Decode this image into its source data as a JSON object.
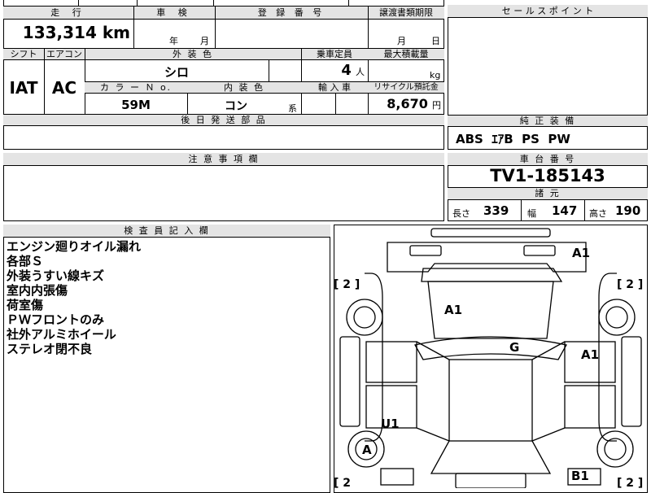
{
  "info": {
    "mileage_header": "走 行",
    "mileage_value": "133,314",
    "mileage_unit": "km",
    "shaken_header": "車 検",
    "shaken_year": "年",
    "shaken_month": "月",
    "plate_header": "登 録 番 号",
    "transfer_header": "譲渡書類期限",
    "transfer_month": "月",
    "transfer_day": "日",
    "shift_header": "シフト",
    "shift_value": "IAT",
    "ac_header": "エアコン",
    "ac_value": "AC",
    "exterior_header": "外 装 色",
    "exterior_value": "シロ",
    "capacity_header": "乗車定員",
    "capacity_value": "4",
    "capacity_unit": "人",
    "load_header": "最大積載量",
    "load_unit": "kg",
    "color_no_header": "カ ラ ー Ｎ o.",
    "color_no_value": "59M",
    "interior_header": "内 装 色",
    "interior_value": "コン",
    "interior_suffix": "系",
    "import_header": "輸 入 車",
    "recycle_header": "リサイクル預託金",
    "recycle_value": "8,670",
    "recycle_unit": "円",
    "later_parts_header": "後 日 発 送 部 品"
  },
  "sales": {
    "header": "セ ー ル ス ポ イ ン ト",
    "equipment_header": "純 正 装 備",
    "equipment_value": "ABS  ｴｱB  PS  PW"
  },
  "caution": {
    "header": "注 意 事 項 欄"
  },
  "chassis": {
    "header": "車 台 番 号",
    "value": "TV1-185143",
    "spec_header": "諸 元",
    "length_label": "長さ",
    "length_value": "339",
    "width_label": "幅",
    "width_value": "147",
    "height_label": "高さ",
    "height_value": "190"
  },
  "inspector": {
    "header": "検 査 員 記 入 欄",
    "notes": [
      "エンジン廻りオイル漏れ",
      "各部Ｓ",
      "外装うすい線キズ",
      "室内内張傷",
      "荷室傷",
      "ＰＷフロントのみ",
      "社外アルミホイール",
      "ステレオ閉不良"
    ]
  },
  "diagram": {
    "marks": {
      "front_right_corner": "A1",
      "hood": "A1",
      "roof": "G",
      "right_side": "A1",
      "left_rear": "U1",
      "left_rear_wheel": "A",
      "rear_right": "B1"
    },
    "tire_scores": {
      "front_left": "[ 2 ]",
      "front_right": "[ 2 ]",
      "rear_left": "[ 2",
      "rear_right": "[ 2 ]"
    }
  }
}
